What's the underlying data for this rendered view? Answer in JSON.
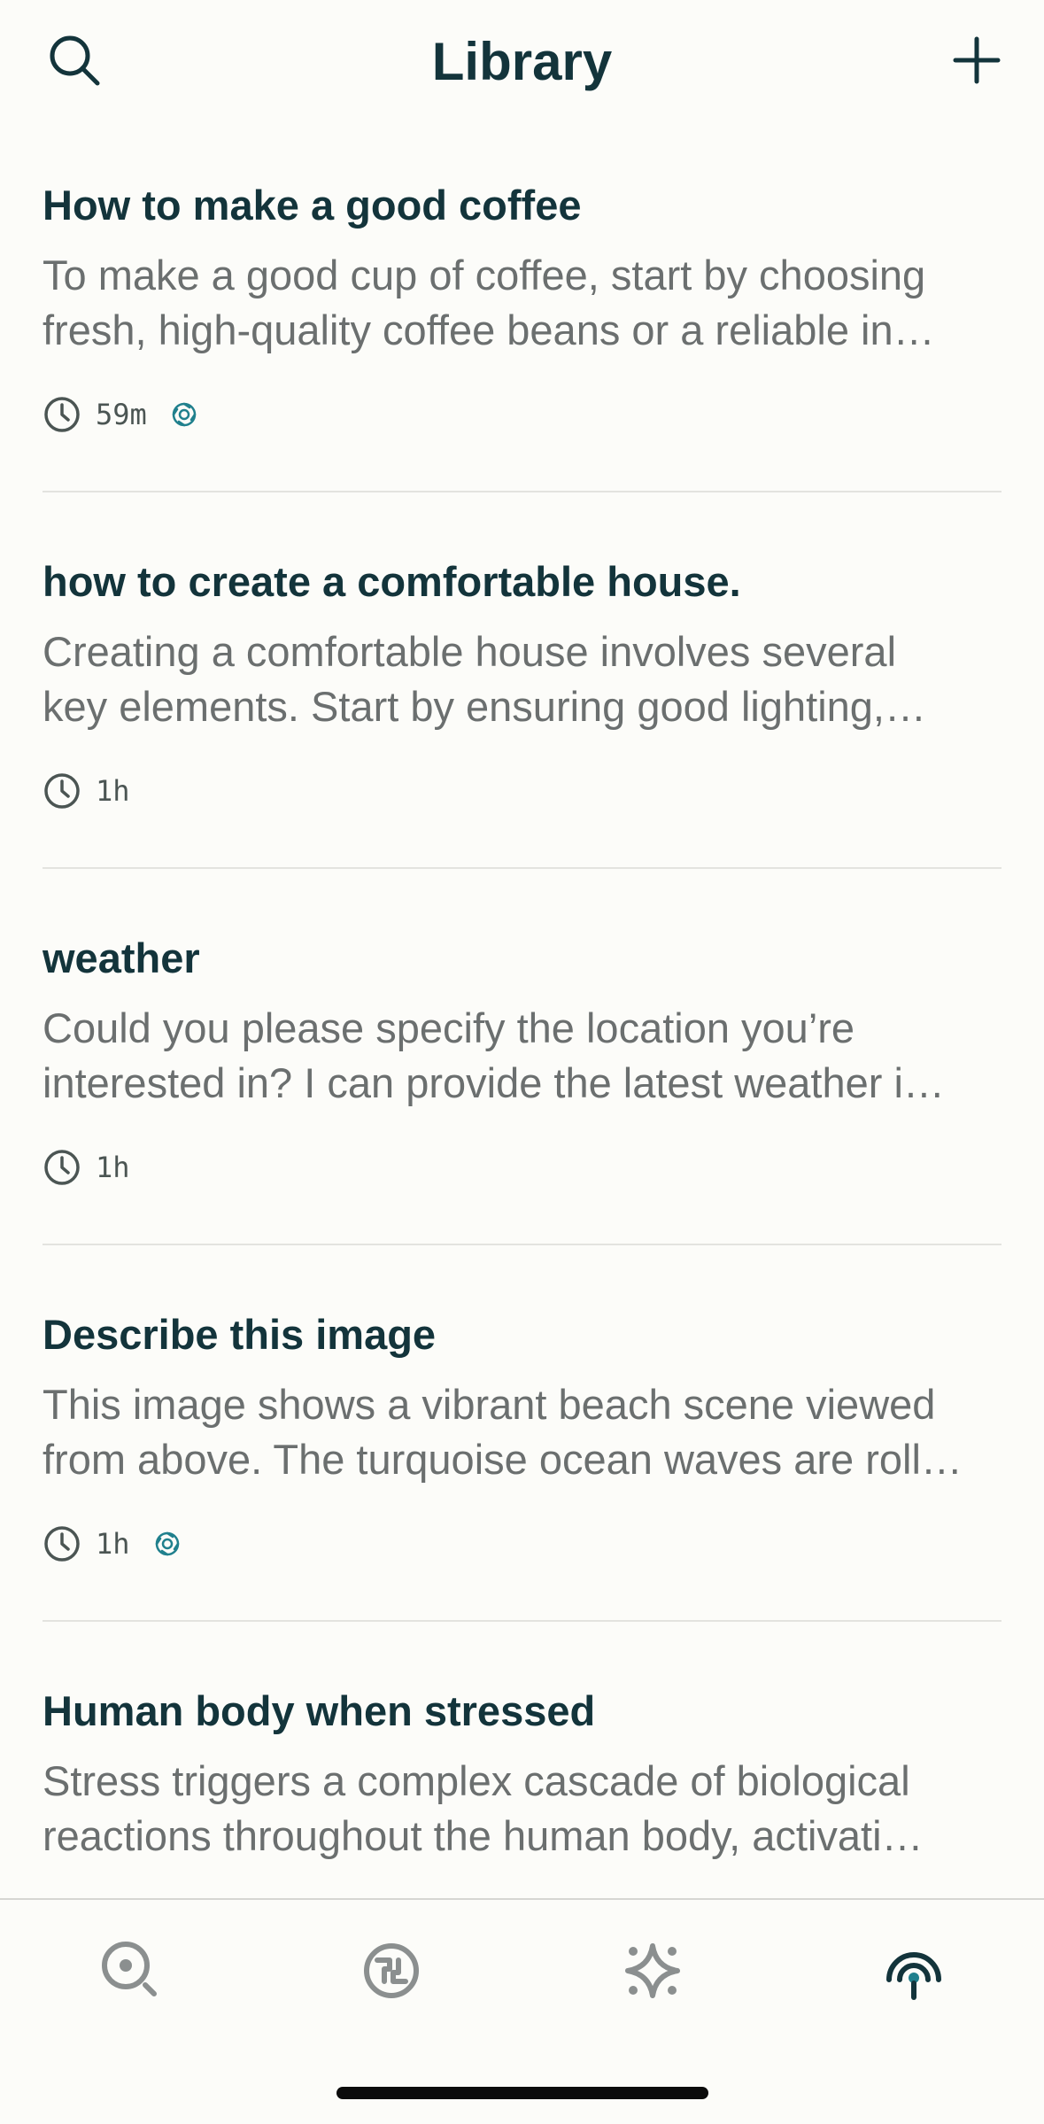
{
  "header": {
    "title": "Library",
    "search_icon": "search-icon",
    "new_icon": "plus-icon"
  },
  "threads": [
    {
      "title": "How to make a good coffee",
      "preview_line1": "To make a good cup of coffee, start by choosing",
      "preview_line2": "fresh, high-quality coffee beans or a reliable in…",
      "time": "59m",
      "synced": true
    },
    {
      "title": "how to create a comfortable house.",
      "preview_line1": "Creating a comfortable house involves several",
      "preview_line2": "key elements. Start by ensuring good lighting,…",
      "time": "1h",
      "synced": false
    },
    {
      "title": "weather",
      "preview_line1": "Could you please specify the location you’re",
      "preview_line2": "interested in? I can provide the latest weather i…",
      "time": "1h",
      "synced": false
    },
    {
      "title": "Describe this image",
      "preview_line1": "This image shows a vibrant beach scene viewed",
      "preview_line2": "from above. The turquoise ocean waves are roll…",
      "time": "1h",
      "synced": true
    },
    {
      "title": "Human body when stressed",
      "preview_line1": "Stress triggers a complex cascade of biological",
      "preview_line2": "reactions throughout the human body, activati…",
      "time": "",
      "synced": false
    }
  ],
  "tabbar": {
    "tabs": [
      {
        "icon": "home-search-icon",
        "active": false
      },
      {
        "icon": "discover-icon",
        "active": false
      },
      {
        "icon": "spaces-icon",
        "active": false
      },
      {
        "icon": "library-icon",
        "active": true
      }
    ]
  },
  "colors": {
    "background": "#fcfcf9",
    "title": "#13343b",
    "preview": "#6b6f6f",
    "accent": "#20808d",
    "inactive_icon": "#8b8f8f"
  }
}
